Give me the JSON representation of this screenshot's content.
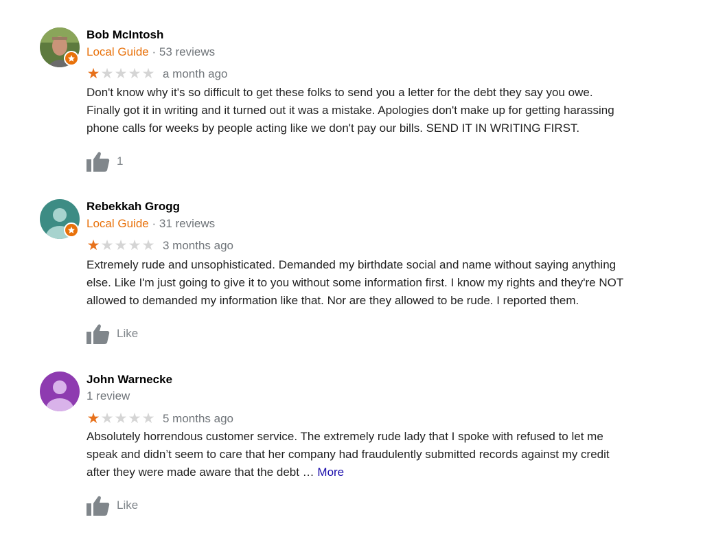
{
  "reviews": [
    {
      "name": "Bob McIntosh",
      "guide_label": "Local Guide",
      "separator": "·",
      "review_count": "53 reviews",
      "rating": 1,
      "max_rating": 5,
      "time": "a month ago",
      "lines": [
        "Don't know why it's so difficult to get these folks to send you a letter for the debt they say you owe.",
        "Finally got it in writing and it turned out it was a mistake.  Apologies don't make up for getting harassing",
        "phone calls for weeks by people acting like we don't pay our bills.  SEND IT IN WRITING FIRST."
      ],
      "like_label": "1"
    },
    {
      "name": "Rebekkah Grogg",
      "guide_label": "Local Guide",
      "separator": "·",
      "review_count": "31 reviews",
      "rating": 1,
      "max_rating": 5,
      "time": "3 months ago",
      "lines": [
        "Extremely rude and unsophisticated. Demanded my birthdate social and name without saying anything",
        "else. Like I'm just going to give it to you without some information first. I know my rights and they're NOT",
        "allowed to demanded my information like that. Nor are they allowed to be rude. I reported them."
      ],
      "like_label": "Like"
    },
    {
      "name": "John Warnecke",
      "review_count": "1 review",
      "rating": 1,
      "max_rating": 5,
      "time": "5 months ago",
      "lines": [
        "Absolutely horrendous customer service. The extremely rude lady that I spoke with refused to let me",
        "speak and didn’t seem to care that her company had fraudulently submitted records against my credit",
        "after they were made aware that the debt … "
      ],
      "more_label": "More",
      "like_label": "Like"
    }
  ],
  "colors": {
    "local_guide": "#e8710a",
    "star_on": "#e7711b",
    "star_off": "#d5d5d5",
    "link": "#1a0dab",
    "avatar_teal": "#3d8c84",
    "avatar_purple": "#8e3bb0"
  },
  "icons": {
    "like": "thumbs-up-icon",
    "badge": "local-guide-star-icon"
  }
}
